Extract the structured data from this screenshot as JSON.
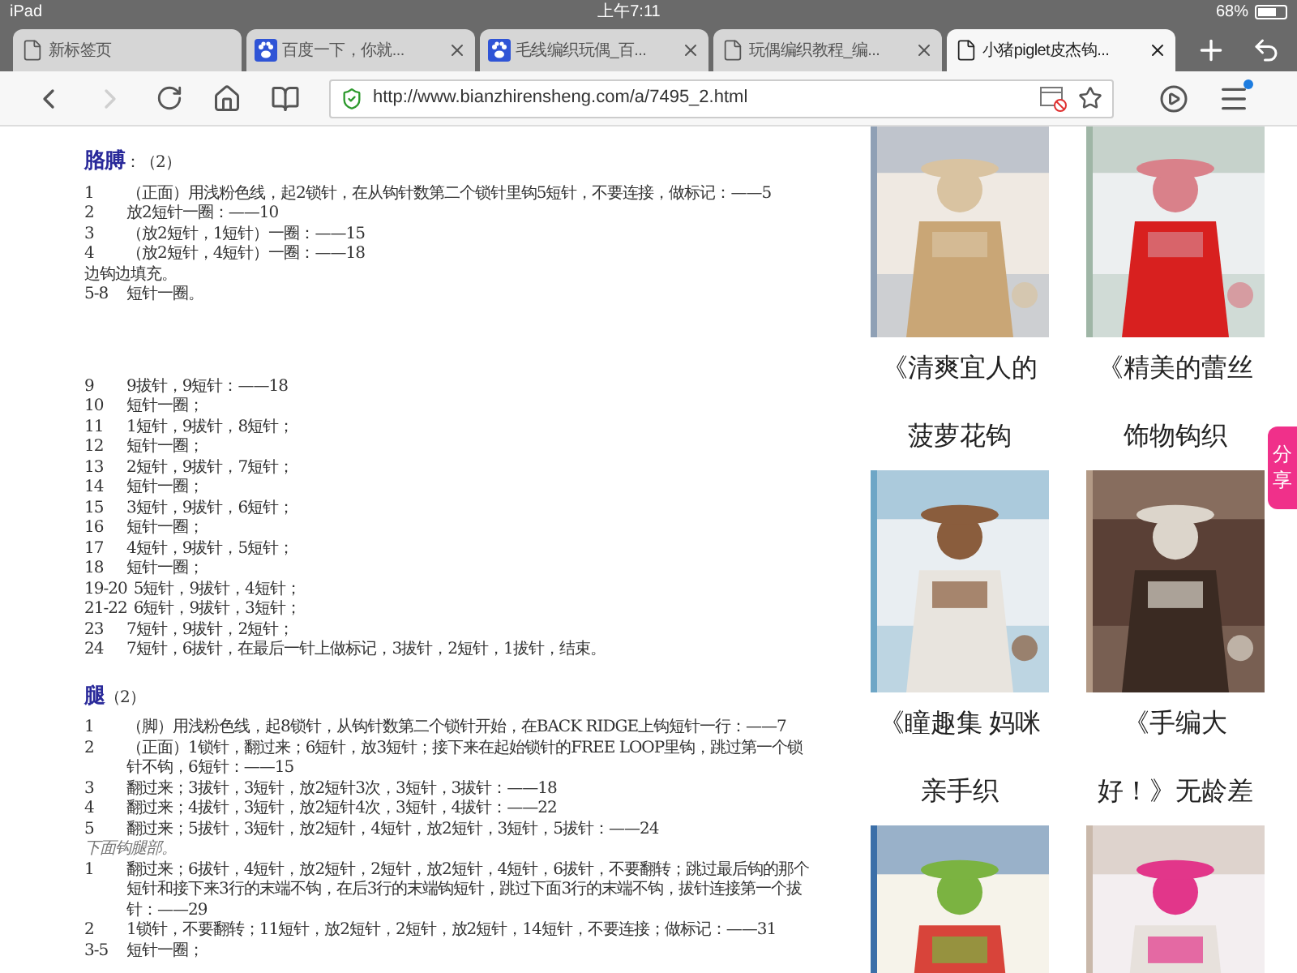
{
  "status_bar": {
    "device": "iPad",
    "time": "上午7:11",
    "battery": "68%"
  },
  "tabs": [
    {
      "title": "新标签页",
      "kind": "page",
      "closable": false,
      "selected": false
    },
    {
      "title": "百度一下，你就...",
      "kind": "paw",
      "closable": true,
      "selected": false
    },
    {
      "title": "毛线编织玩偶_百...",
      "kind": "paw",
      "closable": true,
      "selected": false
    },
    {
      "title": "玩偶编织教程_编...",
      "kind": "page",
      "closable": true,
      "selected": false
    },
    {
      "title": "小猪piglet皮杰钩...",
      "kind": "page",
      "closable": true,
      "selected": true
    }
  ],
  "toolbar": {
    "forward_disabled": true,
    "url": "http://www.bianzhirensheng.com/a/7495_2.html",
    "secure": true,
    "menu_badge": true
  },
  "document": {
    "sections": [
      {
        "heading": "胳膊",
        "count": "：（2）",
        "blocks": [
          [
            {
              "num": "1",
              "text": "（正面）用浅粉色线，起2锁针，在从钩针数第二个锁针里钩5短针，不要连接，做标记：——5"
            },
            {
              "num": "2",
              "text": "放2短针一圈：——10"
            },
            {
              "num": "3",
              "text": "（放2短针，1短针）一圈：——15"
            },
            {
              "num": "4",
              "text": "（放2短针，4短针）一圈：——18"
            },
            {
              "text": "边钩边填充。"
            },
            {
              "num": "5-8",
              "text": "短针一圈。"
            }
          ],
          [
            {
              "num": "9",
              "text": "9拔针，9短针：——18"
            },
            {
              "num": "10",
              "text": "短针一圈；"
            },
            {
              "num": "11",
              "text": "1短针，9拔针，8短针；"
            },
            {
              "num": "12",
              "text": "短针一圈；"
            },
            {
              "num": "13",
              "text": "2短针，9拔针，7短针；"
            },
            {
              "num": "14",
              "text": "短针一圈；"
            },
            {
              "num": "15",
              "text": "3短针，9拔针，6短针；"
            },
            {
              "num": "16",
              "text": "短针一圈；"
            },
            {
              "num": "17",
              "text": "4短针，9拔针，5短针；"
            },
            {
              "num": "18",
              "text": "短针一圈；"
            },
            {
              "num": "19-20",
              "text": "5短针，9拔针，4短针；"
            },
            {
              "num": "21-22",
              "text": "6短针，9拔针，3短针；"
            },
            {
              "num": "23",
              "text": "7短针，9拔针，2短针；"
            },
            {
              "num": "24",
              "text": "7短针，6拔针，在最后一针上做标记，3拔针，2短针，1拔针，结束。"
            }
          ]
        ]
      },
      {
        "heading": "腿",
        "count": "（2）",
        "blocks": [
          [
            {
              "num": "1",
              "text": "（脚）用浅粉色线，起8锁针，从钩针数第二个锁针开始，在BACK RIDGE上钩短针一行：——7"
            },
            {
              "num": "2",
              "text": "（正面）1锁针，翻过来；6短针，放3短针；接下来在起始锁针的FREE LOOP里钩，跳过第一个锁针不钩，6短针：——15"
            },
            {
              "num": "3",
              "text": "翻过来；3拔针，3短针，放2短针3次，3短针，3拔针：——18"
            },
            {
              "num": "4",
              "text": "翻过来；4拔针，3短针，放2短针4次，3短针，4拔针：——22"
            },
            {
              "num": "5",
              "text": "翻过来；5拔针，3短针，放2短针，4短针，放2短针，3短针，5拔针：——24"
            },
            {
              "kind": "note",
              "text": "下面钩腿部。"
            },
            {
              "num": "1",
              "text": "翻过来；6拔针，4短针，放2短针，2短针，放2短针，4短针，6拔针，不要翻转；跳过最后钩的那个短针和接下来3行的末端不钩，在后3行的末端钩短针，跳过下面3行的末端不钩，拔针连接第一个拔针：——29"
            },
            {
              "num": "2",
              "text": "1锁针，不要翻转；11短针，放2短针，2短针，放2短针，14短针，不要连接；做标记：——31"
            },
            {
              "num": "3-5",
              "text": "短针一圈；"
            }
          ]
        ]
      }
    ]
  },
  "books": [
    {
      "cover": {
        "kind": "picture"
      },
      "title_lines": [
        "《清爽宜人的",
        "菠萝花钩"
      ]
    },
    {
      "cover": {
        "kind": "picture"
      },
      "title_lines": [
        "《精美的蕾丝",
        "饰物钩织"
      ]
    },
    {
      "cover": {
        "kind": "picture"
      },
      "title_lines": [
        "《瞳趣集 妈咪",
        "亲手织"
      ]
    },
    {
      "cover": {
        "kind": "picture"
      },
      "title_lines": [
        "《手编大",
        "好！》无龄差"
      ]
    },
    {
      "cover": {
        "kind": "picture"
      }
    },
    {
      "cover": {
        "kind": "picture"
      }
    }
  ],
  "share_tab": "分享"
}
